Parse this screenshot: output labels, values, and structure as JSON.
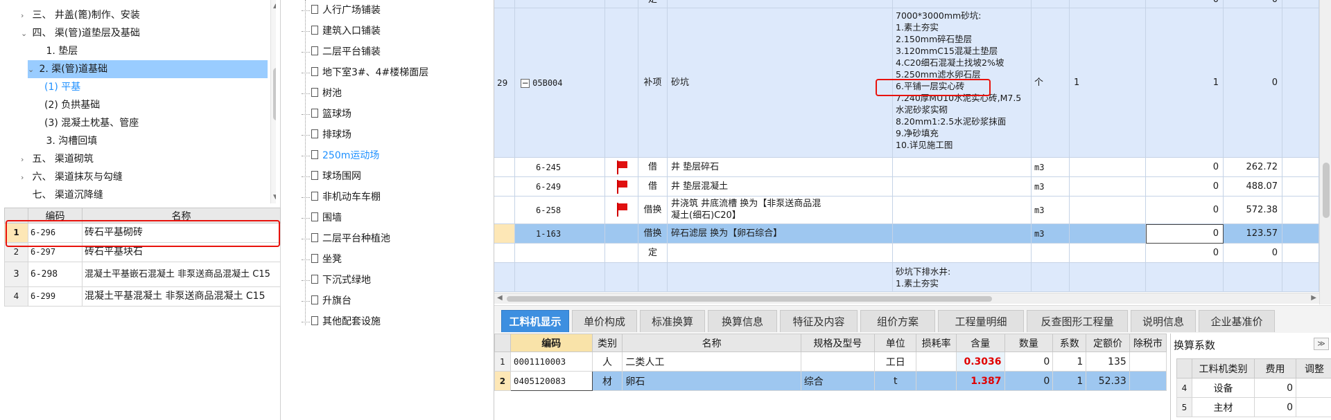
{
  "tree": {
    "items": [
      {
        "label": "三、 井盖(篦)制作、安装",
        "toggle": "›",
        "level": 0
      },
      {
        "label": "四、 渠(管)道垫层及基础",
        "toggle": "⌄",
        "level": 0
      },
      {
        "label": "1. 垫层",
        "toggle": "",
        "level": 1
      },
      {
        "label": "2. 渠(管)道基础",
        "toggle": "⌄",
        "level": 1
      },
      {
        "label": "(1) 平基",
        "toggle": "",
        "level": 2
      },
      {
        "label": "(2) 负拱基础",
        "toggle": "",
        "level": 2
      },
      {
        "label": "(3) 混凝土枕基、管座",
        "toggle": "",
        "level": 2
      },
      {
        "label": "3. 沟槽回填",
        "toggle": "",
        "level": 1
      },
      {
        "label": "五、 渠道砌筑",
        "toggle": "›",
        "level": 0
      },
      {
        "label": "六、 渠道抹灰与勾缝",
        "toggle": "›",
        "level": 0
      },
      {
        "label": "七、 渠道沉降缝",
        "toggle": "",
        "level": 0
      }
    ]
  },
  "quota_list": {
    "headers": [
      "编码",
      "名称"
    ],
    "rows": [
      {
        "n": "1",
        "code": "6-296",
        "name": "砖石平基砌砖"
      },
      {
        "n": "2",
        "code": "6-297",
        "name": "砖石平基块石"
      },
      {
        "n": "3",
        "code": "6-298",
        "name": "混凝土平基嵌石混凝土 非泵送商品混凝土 C15"
      },
      {
        "n": "4",
        "code": "6-299",
        "name": "混凝土平基混凝土 非泵送商品混凝土 C15"
      }
    ]
  },
  "sections": [
    "人行广场铺装",
    "建筑入口铺装",
    "二层平台铺装",
    "地下室3#、4#楼梯面层",
    "树池",
    "篮球场",
    "排球场",
    "250m运动场",
    "球场围网",
    "非机动车车棚",
    "围墙",
    "二层平台种植池",
    "坐凳",
    "下沉式绿地",
    "升旗台",
    "其他配套设施"
  ],
  "main_grid": {
    "top_row": {
      "type": "定",
      "qty": "0",
      "price": "0"
    },
    "item29": {
      "n": "29",
      "code": "05B004",
      "type": "补项",
      "name": "砂坑",
      "unit": "个",
      "qty_expr": "1",
      "qty": "1",
      "price": "0",
      "desc": [
        "7000*3000mm砂坑:",
        "1.素土夯实",
        "2.150mm碎石垫层",
        "3.120mmC15混凝土垫层",
        "4.C20细石混凝土找坡2%坡",
        "5.250mm滤水卵石层",
        "6.平铺一层实心砖",
        "7.240厚MU10水泥实心砖,M7.5",
        "水泥砂浆实砌",
        "8.20mm1:2.5水泥砂浆抹面",
        "9.净砂填充",
        "10.详见施工图"
      ]
    },
    "subrows": [
      {
        "code": "6-245",
        "type": "借",
        "name": "井 垫层碎石",
        "unit": "m3",
        "qty": "0",
        "price": "262.72",
        "flag": true
      },
      {
        "code": "6-249",
        "type": "借",
        "name": "井 垫层混凝土",
        "unit": "m3",
        "qty": "0",
        "price": "488.07",
        "flag": true
      },
      {
        "code": "6-258",
        "type": "借换",
        "name": "井浇筑 井底流槽  换为【非泵送商品混",
        "name2": "凝土(细石)C20】",
        "unit": "m3",
        "qty": "0",
        "price": "572.38",
        "flag": true
      },
      {
        "code": "1-163",
        "type": "借换",
        "name": "碎石滤层  换为【卵石综合】",
        "unit": "m3",
        "qty": "0",
        "price": "123.57",
        "flag": false
      },
      {
        "code": "",
        "type": "定",
        "name": "",
        "unit": "",
        "qty": "0",
        "price": "0",
        "flag": false
      }
    ],
    "next_desc": [
      "砂坑下排水井:",
      "1.素土夯实"
    ]
  },
  "tabs": [
    "工料机显示",
    "单价构成",
    "标准换算",
    "换算信息",
    "特征及内容",
    "组价方案",
    "工程量明细",
    "反查图形工程量",
    "说明信息",
    "企业基准价"
  ],
  "resource_grid": {
    "headers": [
      "编码",
      "类别",
      "名称",
      "规格及型号",
      "单位",
      "损耗率",
      "含量",
      "数量",
      "系数",
      "定额价",
      "除税市"
    ],
    "rows": [
      {
        "n": "1",
        "code": "0001110003",
        "cat": "人",
        "name": "二类人工",
        "spec": "",
        "unit": "工日",
        "loss": "",
        "content": "0.3036",
        "qty": "0",
        "coef": "1",
        "price": "135"
      },
      {
        "n": "2",
        "code": "0405120083",
        "cat": "材",
        "name": "卵石",
        "spec": "综合",
        "unit": "t",
        "loss": "",
        "content": "1.387",
        "qty": "0",
        "coef": "1",
        "price": "52.33"
      }
    ]
  },
  "conversion_panel": {
    "title": "换算系数",
    "collapse": "≫",
    "headers": [
      "工料机类别",
      "费用",
      "调整"
    ],
    "rows": [
      {
        "n": "4",
        "cat": "设备",
        "fee": "0"
      },
      {
        "n": "5",
        "cat": "主材",
        "fee": "0"
      }
    ]
  },
  "colors": {
    "accent": "#3d8fe0",
    "selected_row": "#9ec7f0",
    "highlight_box": "#e8120c",
    "link": "#1e90ff"
  }
}
